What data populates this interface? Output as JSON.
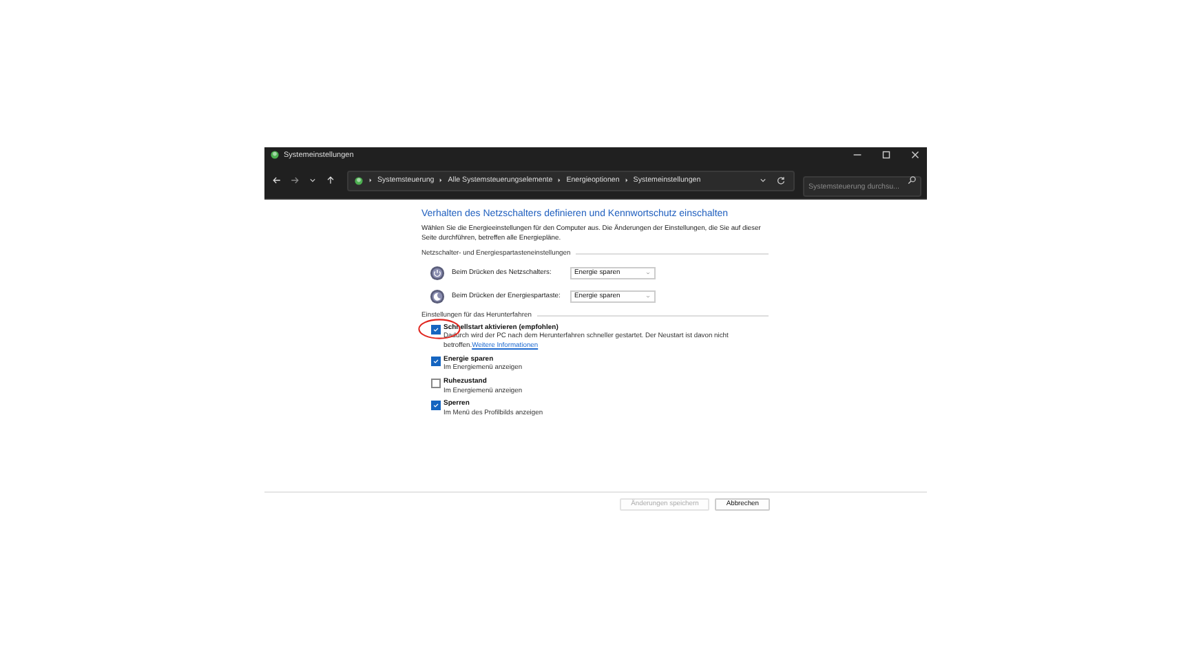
{
  "window": {
    "title": "Systemeinstellungen"
  },
  "nav": {
    "breadcrumbs": [
      "Systemsteuerung",
      "Alle Systemsteuerungselemente",
      "Energieoptionen",
      "Systemeinstellungen"
    ],
    "search": {
      "placeholder": "Systemsteuerung durchsu..."
    }
  },
  "heading": "Verhalten des Netzschalters definieren und Kennwortschutz einschalten",
  "intro": "Wählen Sie die Energieeinstellungen für den Computer aus. Die Änderungen der Einstellungen, die Sie auf dieser Seite durchführen, betreffen alle Energiepläne.",
  "button_section": {
    "title": "Netzschalter- und Energiespartasteneinstellungen",
    "rows": [
      {
        "kind": "power",
        "label": "Beim Drücken des Netzschalters:",
        "value": "Energie sparen"
      },
      {
        "kind": "sleep",
        "label": "Beim Drücken der Energiespartaste:",
        "value": "Energie sparen"
      }
    ]
  },
  "shutdown_section": {
    "title": "Einstellungen für das Herunterfahren",
    "options": [
      {
        "label": "Schnellstart aktivieren (empfohlen)",
        "checked": true,
        "highlighted": true,
        "description": "Dadurch wird der PC nach dem Herunterfahren schneller gestartet. Der Neustart ist davon nicht betroffen.",
        "link": "Weitere Informationen"
      },
      {
        "label": "Energie sparen",
        "checked": true,
        "highlighted": false,
        "description": "Im Energiemenü anzeigen"
      },
      {
        "label": "Ruhezustand",
        "checked": false,
        "highlighted": false,
        "description": "Im Energiemenü anzeigen"
      },
      {
        "label": "Sperren",
        "checked": true,
        "highlighted": false,
        "description": "Im Menü des Profilbilds anzeigen"
      }
    ]
  },
  "footer": {
    "buttons": [
      {
        "label": "Änderungen speichern",
        "disabled": true
      },
      {
        "label": "Abbrechen",
        "disabled": false
      }
    ]
  }
}
